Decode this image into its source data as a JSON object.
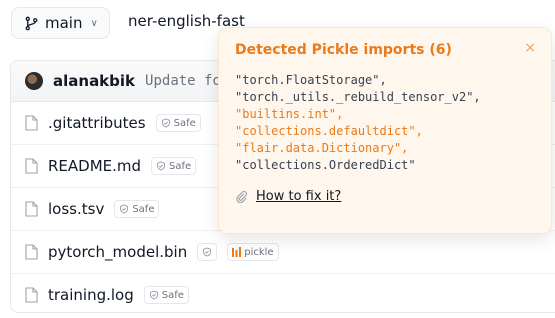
{
  "header": {
    "branch": "main",
    "repo_name": "ner-english-fast"
  },
  "commit": {
    "author": "alanakbik",
    "message": "Update fo"
  },
  "files": [
    {
      "name": ".gitattributes",
      "badge": "Safe"
    },
    {
      "name": "README.md",
      "badge": "Safe"
    },
    {
      "name": "loss.tsv",
      "badge": "Safe"
    },
    {
      "name": "pytorch_model.bin",
      "badge": "pickle"
    },
    {
      "name": "training.log",
      "badge": "Safe"
    }
  ],
  "popup": {
    "title": "Detected Pickle imports (6)",
    "close_label": "×",
    "imports": [
      {
        "text": "\"torch.FloatStorage\",",
        "flagged": false
      },
      {
        "text": "\"torch._utils._rebuild_tensor_v2\",",
        "flagged": false
      },
      {
        "text": "\"builtins.int\",",
        "flagged": true
      },
      {
        "text": "\"collections.defaultdict\",",
        "flagged": true
      },
      {
        "text": "\"flair.data.Dictionary\",",
        "flagged": true
      },
      {
        "text": "\"collections.OrderedDict\"",
        "flagged": false
      }
    ],
    "fix_link": "How to fix it?"
  },
  "colors": {
    "accent_orange": "#ea7a1a",
    "popup_bg": "#fff7ed"
  }
}
